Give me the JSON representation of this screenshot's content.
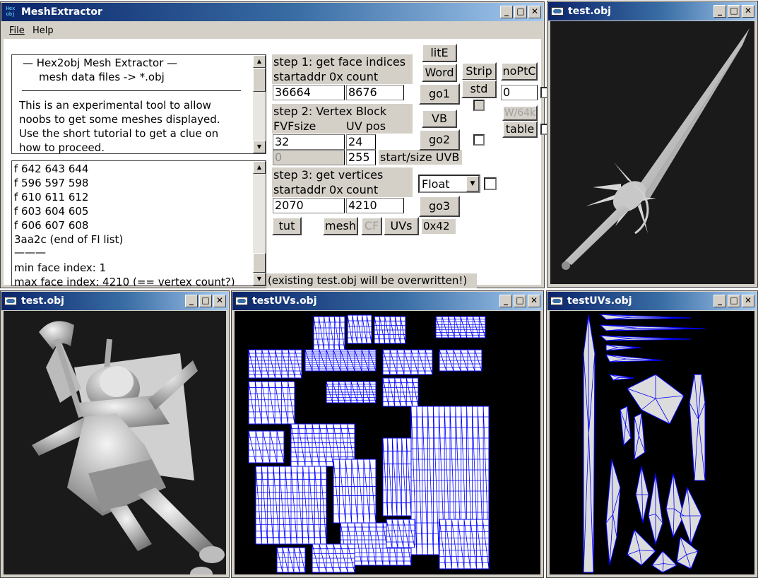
{
  "main": {
    "title": "MeshExtractor",
    "icon_text": "Hex obj",
    "menu": [
      "File",
      "Help"
    ],
    "info": {
      "line1": "—   Hex2obj Mesh Extractor   —",
      "line2": "mesh data files -> *.obj",
      "body": [
        "This is an experimental tool to allow",
        "noobs to get some meshes displayed.",
        "Use the short tutorial to get a clue on",
        "how to proceed."
      ]
    },
    "log": [
      "f  642 643 644",
      "f  596 597 598",
      "f  610 611 612",
      "f  603 604 605",
      "f  606 607 608",
      "3aa2c (end of FI list)",
      "———",
      "min face index: 1",
      "max face index: 4210 (== vertex count?)"
    ],
    "step1": {
      "title": "step 1: get face indices",
      "addr_label": "startaddr 0x",
      "count_label": "count",
      "addr": "36664",
      "count": "8676"
    },
    "step2": {
      "title": "step 2: Vertex Block",
      "fvf_label": "FVFsize",
      "uv_label": "UV pos",
      "fvf": "32",
      "uv": "24",
      "start_uvb": "0",
      "size_uvb": "255",
      "uvb_label": "start/size UVB"
    },
    "step3": {
      "title": "step 3: get vertices",
      "addr_label": "startaddr 0x",
      "count_label": "count",
      "addr": "2070",
      "count": "4210",
      "type": "Float"
    },
    "buttons": {
      "lite": "litE",
      "word": "Word",
      "strip": "Strip",
      "noptc": "noPtC",
      "go1": "go1",
      "std": "std",
      "vb": "VB",
      "w64k": "W/64k",
      "table": "table",
      "go2": "go2",
      "go3": "go3",
      "tut": "tut",
      "mesh": "mesh",
      "cf": "CF",
      "uvs": "UVs"
    },
    "noptc_value": "0",
    "hex_value": "0x42",
    "status": "(existing test.obj will be overwritten!)"
  },
  "viewers": [
    {
      "title": "test.obj",
      "content": "sword-mesh-render"
    },
    {
      "title": "test.obj",
      "content": "character-mesh-render"
    },
    {
      "title": "testUVs.obj",
      "content": "uv-wireframe"
    },
    {
      "title": "testUVs.obj",
      "content": "uv-wireframe"
    }
  ],
  "colors": {
    "titlebar": "#0a246a",
    "uv_wire": "#0000ff",
    "viewport_bg": "#1a1a1a"
  }
}
